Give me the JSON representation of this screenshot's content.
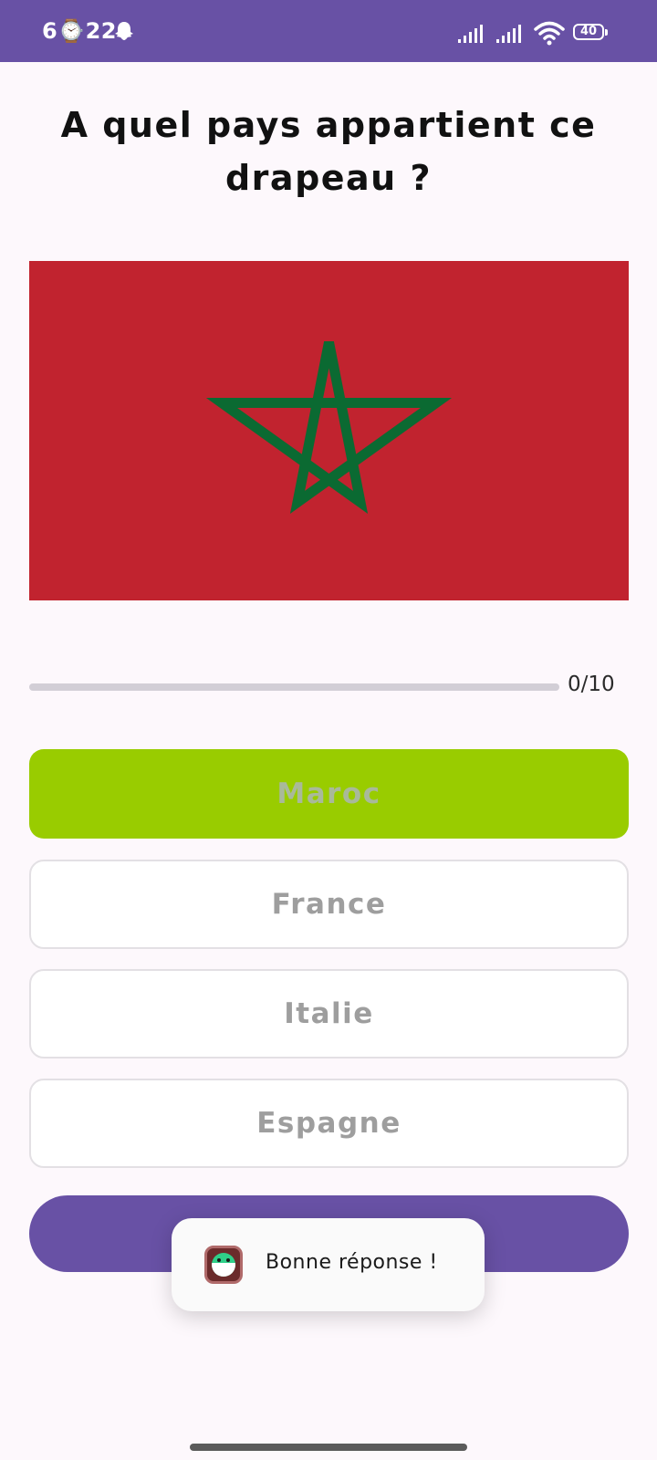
{
  "status_bar": {
    "time": "6⌚22",
    "battery": "40",
    "icons": [
      "ghost-icon",
      "signal-icon",
      "signal-icon",
      "wifi-icon",
      "battery-icon"
    ]
  },
  "quiz": {
    "question": "A quel pays appartient ce drapeau ?",
    "flag_icon": "morocco-flag",
    "progress": {
      "text": "0/10",
      "fraction": 0.0
    },
    "answers": [
      {
        "label": "Maroc",
        "state": "correct"
      },
      {
        "label": "France",
        "state": "default"
      },
      {
        "label": "Italie",
        "state": "default"
      },
      {
        "label": "Espagne",
        "state": "default"
      }
    ]
  },
  "toast": {
    "message": "Bonne réponse !",
    "icon": "app-icon"
  },
  "colors": {
    "primary": "#6851a5",
    "correct": "#99cc00",
    "flag_red": "#c1232f",
    "flag_green": "#0b6a32"
  }
}
